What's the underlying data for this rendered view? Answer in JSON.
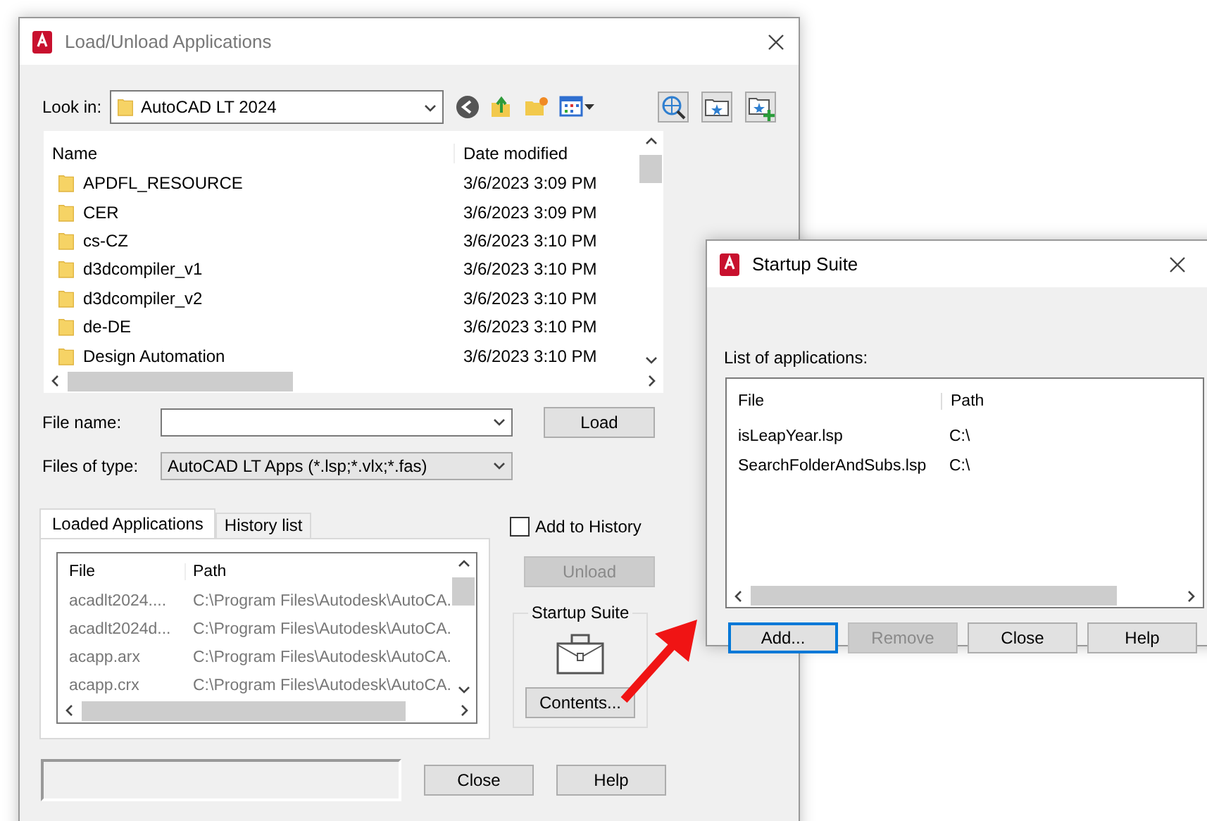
{
  "main_dialog": {
    "title": "Load/Unload Applications",
    "look_in": {
      "label": "Look in:",
      "value": "AutoCAD LT 2024"
    },
    "file_list": {
      "columns": [
        "Name",
        "Date modified"
      ],
      "rows": [
        {
          "name": "APDFL_RESOURCE",
          "date": "3/6/2023 3:09 PM"
        },
        {
          "name": "CER",
          "date": "3/6/2023 3:09 PM"
        },
        {
          "name": "cs-CZ",
          "date": "3/6/2023 3:10 PM"
        },
        {
          "name": "d3dcompiler_v1",
          "date": "3/6/2023 3:10 PM"
        },
        {
          "name": "d3dcompiler_v2",
          "date": "3/6/2023 3:10 PM"
        },
        {
          "name": "de-DE",
          "date": "3/6/2023 3:10 PM"
        },
        {
          "name": "Design Automation",
          "date": "3/6/2023 3:10 PM"
        }
      ]
    },
    "file_name": {
      "label": "File name:"
    },
    "load_button": "Load",
    "files_of_type": {
      "label": "Files of type:",
      "value": "AutoCAD LT Apps (*.lsp;*.vlx;*.fas)"
    },
    "tabs": [
      {
        "label": "Loaded Applications",
        "selected": true
      },
      {
        "label": "History list",
        "selected": false
      }
    ],
    "loaded_list": {
      "columns": [
        "File",
        "Path"
      ],
      "rows": [
        {
          "file": "acadlt2024....",
          "path": "C:\\Program Files\\Autodesk\\AutoCA."
        },
        {
          "file": "acadlt2024d...",
          "path": "C:\\Program Files\\Autodesk\\AutoCA."
        },
        {
          "file": "acapp.arx",
          "path": "C:\\Program Files\\Autodesk\\AutoCA."
        },
        {
          "file": "acapp.crx",
          "path": "C:\\Program Files\\Autodesk\\AutoCA."
        }
      ]
    },
    "add_to_history": {
      "label": "Add to History",
      "checked": false
    },
    "unload_button": {
      "label": "Unload",
      "disabled": true
    },
    "startup_suite": {
      "title": "Startup Suite",
      "button": "Contents..."
    },
    "buttons": [
      "Close",
      "Help"
    ]
  },
  "startup_dialog": {
    "title": "Startup Suite",
    "list_label": "List of applications:",
    "columns": [
      "File",
      "Path"
    ],
    "rows": [
      {
        "file": "isLeapYear.lsp",
        "path": "C:\\"
      },
      {
        "file": "SearchFolderAndSubs.lsp",
        "path": "C:\\"
      }
    ],
    "buttons": [
      {
        "label": "Add...",
        "disabled": false,
        "focused": true
      },
      {
        "label": "Remove",
        "disabled": true,
        "focused": false
      },
      {
        "label": "Close",
        "disabled": false,
        "focused": false
      },
      {
        "label": "Help",
        "disabled": false,
        "focused": false
      }
    ]
  }
}
